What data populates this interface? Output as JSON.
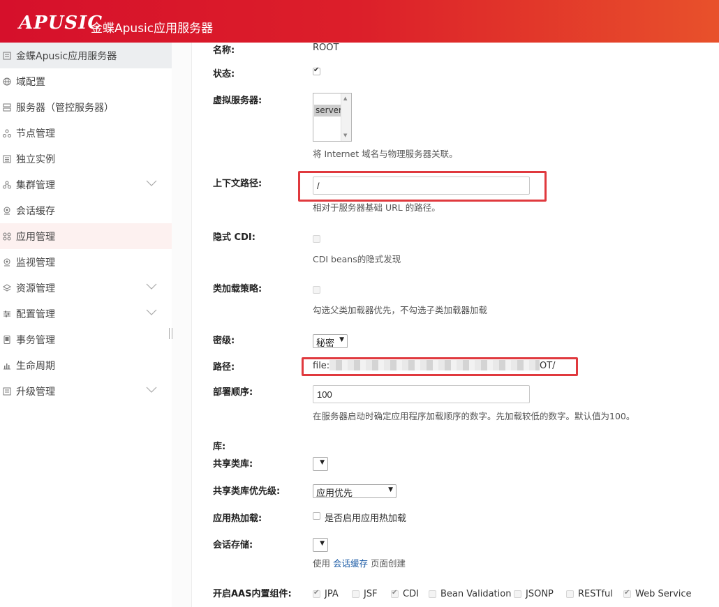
{
  "header": {
    "logo": "APUSIC",
    "title": "金蝶Apusic应用服务器"
  },
  "sidebar": {
    "items": [
      {
        "label": "金蝶Apusic应用服务器"
      },
      {
        "label": "域配置"
      },
      {
        "label": "服务器（管控服务器）"
      },
      {
        "label": "节点管理"
      },
      {
        "label": "独立实例"
      },
      {
        "label": "集群管理"
      },
      {
        "label": "会话缓存"
      },
      {
        "label": "应用管理"
      },
      {
        "label": "监视管理"
      },
      {
        "label": "资源管理"
      },
      {
        "label": "配置管理"
      },
      {
        "label": "事务管理"
      },
      {
        "label": "生命周期"
      },
      {
        "label": "升级管理"
      }
    ]
  },
  "form": {
    "name_label": "名称:",
    "name_value": "ROOT",
    "status_label": "状态:",
    "status_checked": true,
    "vserver_label": "虚拟服务器:",
    "vserver_option": "server",
    "vserver_help": "将 Internet 域名与物理服务器关联。",
    "context_label": "上下文路径:",
    "context_value": "/",
    "context_help": "相对于服务器基础 URL 的路径。",
    "cdi_label": "隐式 CDI:",
    "cdi_help": "CDI beans的隐式发现",
    "classload_label": "类加载策略:",
    "classload_help": "勾选父类加载器优先，不勾选子类加载器加载",
    "secret_label": "密级:",
    "secret_value": "秘密",
    "path_label": "路径:",
    "path_prefix": "file:",
    "path_suffix": "OT/",
    "order_label": "部署顺序:",
    "order_value": "100",
    "order_help": "在服务器启动时确定应用程序加载顺序的数字。先加载较低的数字。默认值为100。",
    "lib_label": "库:",
    "shared_lib_label": "共享类库:",
    "shared_lib_priority_label": "共享类库优先级:",
    "shared_lib_priority_value": "应用优先",
    "hot_reload_label": "应用热加载:",
    "hot_reload_text": "是否启用应用热加载",
    "session_store_label": "会话存储:",
    "session_help_prefix": "使用",
    "session_help_link": "会话缓存",
    "session_help_suffix": "页面创建",
    "components_label": "开启AAS内置组件:",
    "components": [
      {
        "name": "JPA",
        "checked": true
      },
      {
        "name": "JSF",
        "checked": false
      },
      {
        "name": "CDI",
        "checked": true
      },
      {
        "name": "Bean Validation",
        "checked": false
      },
      {
        "name": "JSONP",
        "checked": false
      },
      {
        "name": "RESTful",
        "checked": false
      },
      {
        "name": "Web Service",
        "checked": true
      }
    ]
  }
}
